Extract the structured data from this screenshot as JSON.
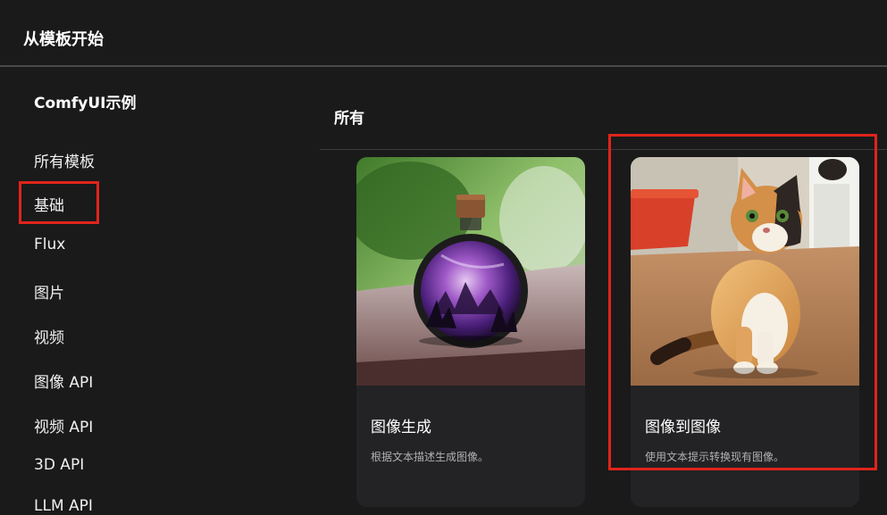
{
  "dialog": {
    "title": "从模板开始"
  },
  "sidebar": {
    "heading": "ComfyUI示例",
    "items": [
      {
        "label": "所有模板"
      },
      {
        "label": "基础"
      },
      {
        "label": "Flux"
      },
      {
        "label": "图片"
      },
      {
        "label": "视频"
      },
      {
        "label": "图像 API"
      },
      {
        "label": "视频 API"
      },
      {
        "label": "3D API"
      },
      {
        "label": "LLM API"
      }
    ]
  },
  "main": {
    "section_title": "所有",
    "cards": [
      {
        "title": "图像生成",
        "description": "根据文本描述生成图像。"
      },
      {
        "title": "图像到图像",
        "description": "使用文本提示转换现有图像。"
      }
    ]
  },
  "annotation_color": "#e0241b"
}
